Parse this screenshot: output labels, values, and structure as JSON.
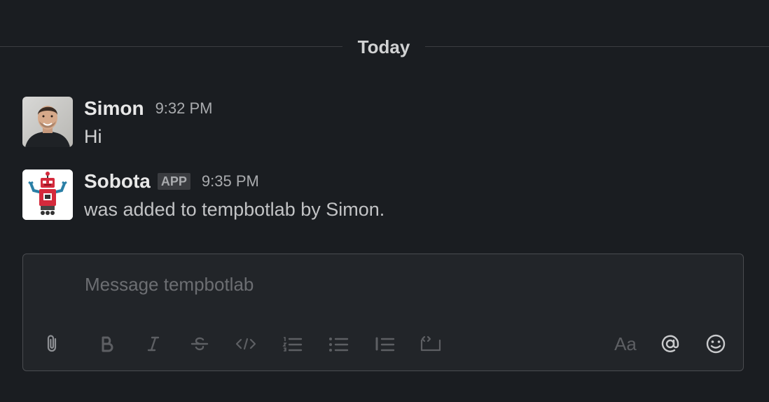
{
  "divider": {
    "label": "Today"
  },
  "messages": [
    {
      "sender": "Simon",
      "time": "9:32 PM",
      "text": "Hi",
      "avatar": "user-photo"
    },
    {
      "sender": "Sobota",
      "badge": "APP",
      "time": "9:35 PM",
      "text": "was added to tempbotlab by Simon.",
      "avatar": "robot-icon"
    }
  ],
  "composer": {
    "placeholder": "Message tempbotlab",
    "value": "",
    "toolbar": [
      {
        "name": "attach-icon",
        "state": "enabled"
      },
      {
        "name": "bold-icon",
        "state": "disabled"
      },
      {
        "name": "italic-icon",
        "state": "disabled"
      },
      {
        "name": "strikethrough-icon",
        "state": "disabled"
      },
      {
        "name": "code-icon",
        "state": "disabled"
      },
      {
        "name": "ordered-list-icon",
        "state": "disabled"
      },
      {
        "name": "bulleted-list-icon",
        "state": "disabled"
      },
      {
        "name": "quote-icon",
        "state": "disabled"
      },
      {
        "name": "code-block-icon",
        "state": "disabled"
      },
      {
        "name": "formatting-toggle-icon",
        "label": "Aa",
        "state": "disabled"
      },
      {
        "name": "mention-icon",
        "state": "enabled"
      },
      {
        "name": "emoji-icon",
        "state": "enabled"
      }
    ]
  },
  "colors": {
    "background": "#1a1d21",
    "composer_background": "#222529",
    "text": "#d1d2d3",
    "muted_text": "#a9abae",
    "robot_red": "#d42a3c",
    "robot_blue": "#2a7fa6"
  }
}
